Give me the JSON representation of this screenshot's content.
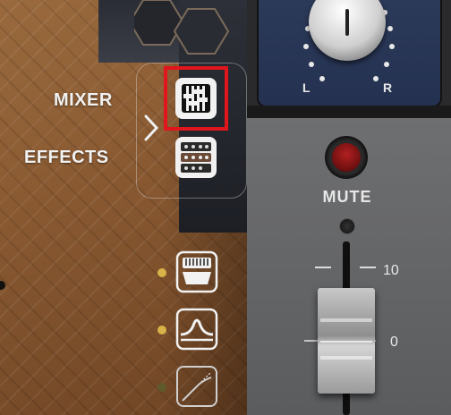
{
  "nav": {
    "mixer_label": "MIXER",
    "effects_label": "EFFECTS"
  },
  "channel": {
    "pan_left": "L",
    "pan_right": "R",
    "mute_label": "MUTE",
    "fader_scale_top": "10",
    "fader_scale_mid": "0"
  },
  "icons": {
    "mixer": "mixer-faders-icon",
    "effects": "effects-rack-icon",
    "preamp": "preamp-icon",
    "eq": "eq-bell-icon",
    "dynamics": "compressor-curve-icon",
    "chevron": "chevron-right-icon"
  },
  "colors": {
    "selection_highlight": "#e0161c",
    "module_active_dot": "#d9b348",
    "module_inactive_dot": "#5f5a2c",
    "pan_panel": "#2c3a5a",
    "mute_led": "#b22020"
  },
  "modules": [
    {
      "icon": "preamp-icon",
      "active": true
    },
    {
      "icon": "eq-bell-icon",
      "active": true
    },
    {
      "icon": "compressor-curve-icon",
      "active": false
    }
  ]
}
